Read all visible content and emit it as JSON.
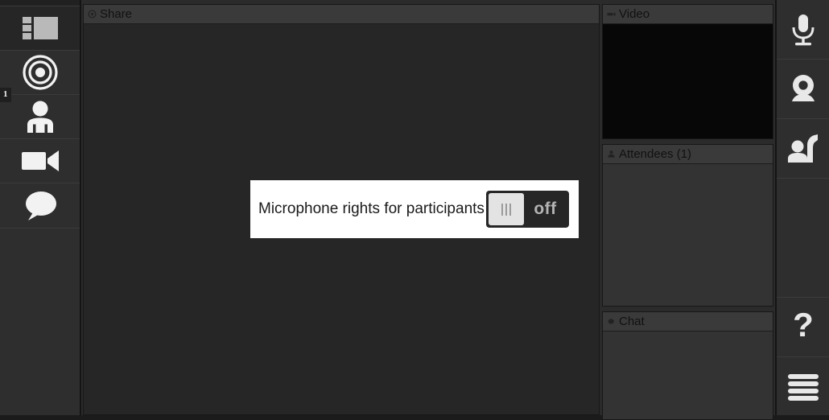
{
  "sidebar": {
    "items": [
      {
        "name": "layout",
        "label": "Layout",
        "icon": "layout-icon",
        "badge": null,
        "active": true
      },
      {
        "name": "record",
        "label": "Record",
        "icon": "record-target-icon",
        "badge": null,
        "active": false
      },
      {
        "name": "attendees",
        "label": "Attendees",
        "icon": "person-icon",
        "badge": "1",
        "active": false
      },
      {
        "name": "video",
        "label": "Video",
        "icon": "camcorder-icon",
        "badge": null,
        "active": false
      },
      {
        "name": "chat",
        "label": "Chat",
        "icon": "chat-bubble-icon",
        "badge": null,
        "active": false
      }
    ]
  },
  "share_panel": {
    "title": "Share",
    "icon": "circle-dot-icon"
  },
  "video_panel": {
    "title": "Video",
    "icon": "webcam-small-icon"
  },
  "attendees_panel": {
    "title": "Attendees (1)",
    "icon": "person-small-icon",
    "count": 1
  },
  "chat_panel": {
    "title": "Chat",
    "icon": "dot-icon"
  },
  "toolbar": {
    "items": [
      {
        "name": "microphone",
        "label": "Microphone",
        "icon": "microphone-icon"
      },
      {
        "name": "webcam",
        "label": "Webcam",
        "icon": "webcam-icon"
      },
      {
        "name": "raise-hand",
        "label": "Raise hand",
        "icon": "raise-hand-icon"
      },
      {
        "name": "help",
        "label": "Help",
        "icon": "question-mark-icon"
      },
      {
        "name": "menu",
        "label": "Menu",
        "icon": "hamburger-menu-icon"
      }
    ]
  },
  "dialog": {
    "message": "Microphone rights for participants",
    "toggle": {
      "state_label": "off",
      "state": "off",
      "knob_icon": "grip-lines-icon"
    }
  },
  "colors": {
    "dialog_background": "#ffffff",
    "dialog_text": "#1a1a1a",
    "toggle_track": "#262626",
    "toggle_knob": "#e3e3e3",
    "toggle_label": "#b4b4b4",
    "panel_header": "#3a3a3a",
    "panel_body": "#333333",
    "video_body": "#070707",
    "share_body": "#262626",
    "chrome": "#2e2e2e",
    "icon": "#e8e8e8"
  }
}
